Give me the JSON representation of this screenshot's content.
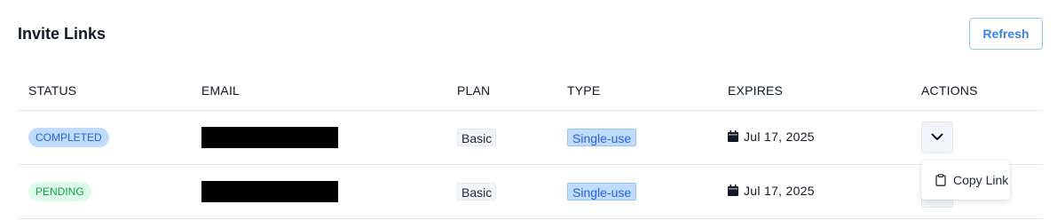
{
  "header": {
    "title": "Invite Links",
    "refresh_label": "Refresh"
  },
  "table": {
    "columns": [
      "STATUS",
      "EMAIL",
      "PLAN",
      "TYPE",
      "EXPIRES",
      "ACTIONS"
    ],
    "rows": [
      {
        "status": "COMPLETED",
        "email": "",
        "plan": "Basic",
        "type": "Single-use",
        "expires": "Jul 17, 2025"
      },
      {
        "status": "PENDING",
        "email": "",
        "plan": "Basic",
        "type": "Single-use",
        "expires": "Jul 17, 2025"
      }
    ]
  },
  "dropdown": {
    "items": [
      {
        "label": "Copy Link",
        "icon": "clipboard-icon"
      }
    ]
  },
  "colors": {
    "accent": "#3b82f6",
    "completed_bg": "#bfdbfe",
    "pending_bg": "#dcfce7"
  }
}
